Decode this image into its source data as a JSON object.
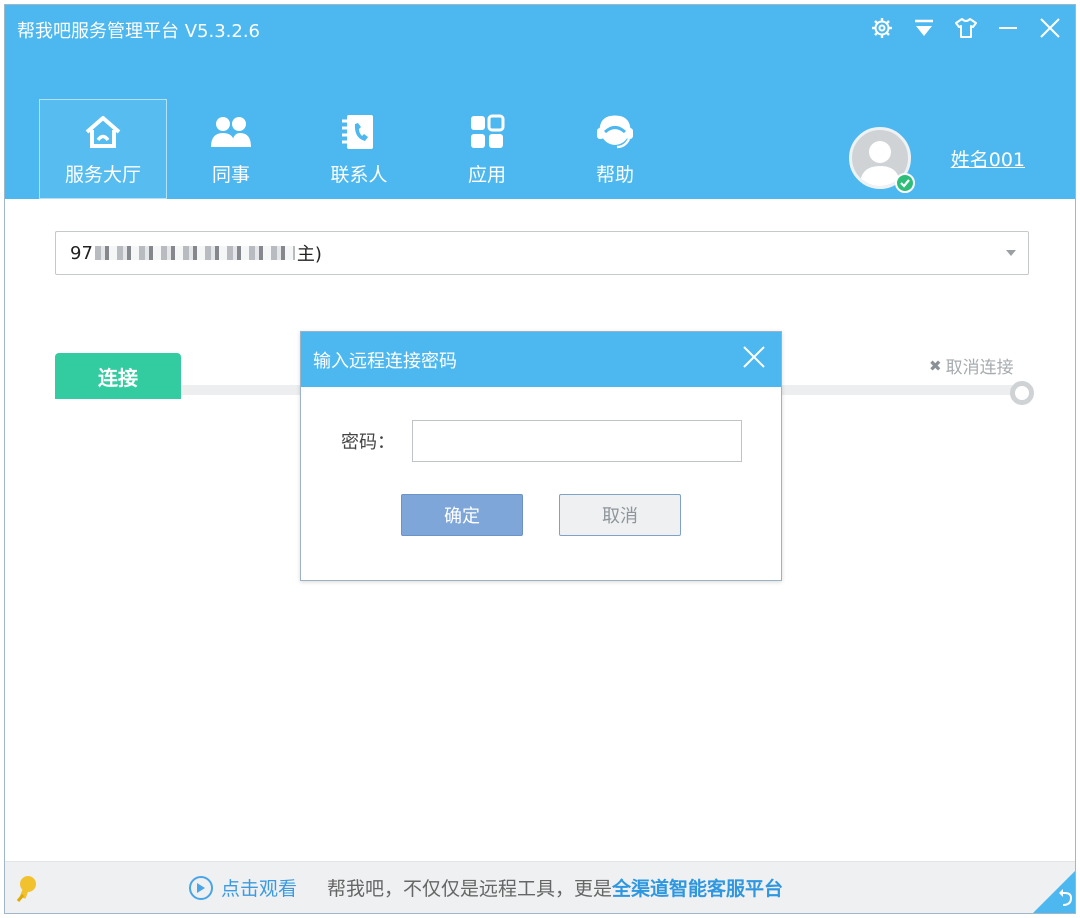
{
  "app": {
    "title": "帮我吧服务管理平台 V5.3.2.6"
  },
  "window_controls": [
    {
      "name": "settings-icon"
    },
    {
      "name": "dropdown-menu-icon"
    },
    {
      "name": "skin-icon"
    },
    {
      "name": "minimize-icon"
    },
    {
      "name": "close-icon"
    }
  ],
  "nav": {
    "items": [
      {
        "label": "服务大厅",
        "icon": "home-icon",
        "active": true
      },
      {
        "label": "同事",
        "icon": "colleagues-icon"
      },
      {
        "label": "联系人",
        "icon": "contacts-icon"
      },
      {
        "label": "应用",
        "icon": "apps-icon"
      },
      {
        "label": "帮助",
        "icon": "help-headset-icon"
      }
    ]
  },
  "user": {
    "name": "姓名001",
    "status": "online"
  },
  "account_select": {
    "prefix": "97",
    "suffix": "主)"
  },
  "connect": {
    "button_label": "连接",
    "cancel_label": "取消连接"
  },
  "dialog": {
    "title": "输入远程连接密码",
    "password_label": "密码：",
    "password_value": "",
    "ok_label": "确定",
    "cancel_label": "取消"
  },
  "footer": {
    "watch_label": "点击观看",
    "slogan_prefix": "帮我吧，不仅仅是远程工具，更是",
    "slogan_emphasis": "全渠道智能客服平台"
  },
  "colors": {
    "brand_blue": "#4db8ef",
    "connect_green": "#32cca0",
    "ok_blue": "#7ea6d8",
    "link_blue": "#2f97e0"
  }
}
